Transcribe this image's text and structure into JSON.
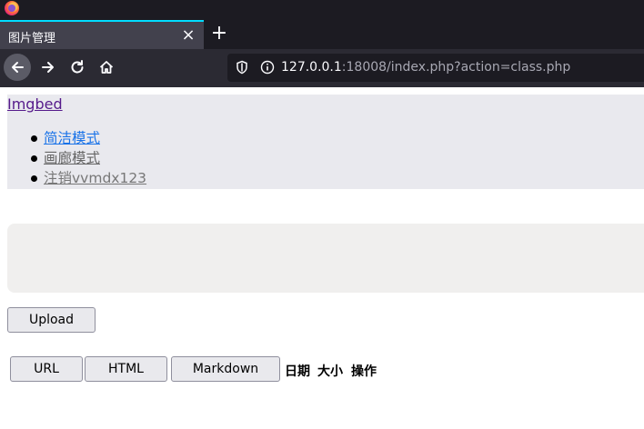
{
  "browser": {
    "tab_title": "图片管理",
    "tab_close": "×",
    "new_tab": "+",
    "url_host": "127.0.0.1",
    "url_rest": ":18008/index.php?action=class.php",
    "accent": "#00ddff"
  },
  "icons": {
    "logo": "firefox-logo",
    "back": "arrow-left-icon",
    "forward": "arrow-right-icon",
    "reload": "reload-icon",
    "home": "home-icon",
    "shield": "shield-icon",
    "info": "info-icon"
  },
  "header": {
    "brand": "Imgbed",
    "nav": [
      {
        "label": "简洁模式"
      },
      {
        "label": "画廊模式"
      },
      {
        "label": "注销vvmdx123"
      }
    ]
  },
  "upload": {
    "label": "Upload"
  },
  "table": {
    "buttons": [
      "URL",
      "HTML",
      "Markdown"
    ],
    "headers": [
      "日期",
      "大小",
      "操作"
    ]
  }
}
